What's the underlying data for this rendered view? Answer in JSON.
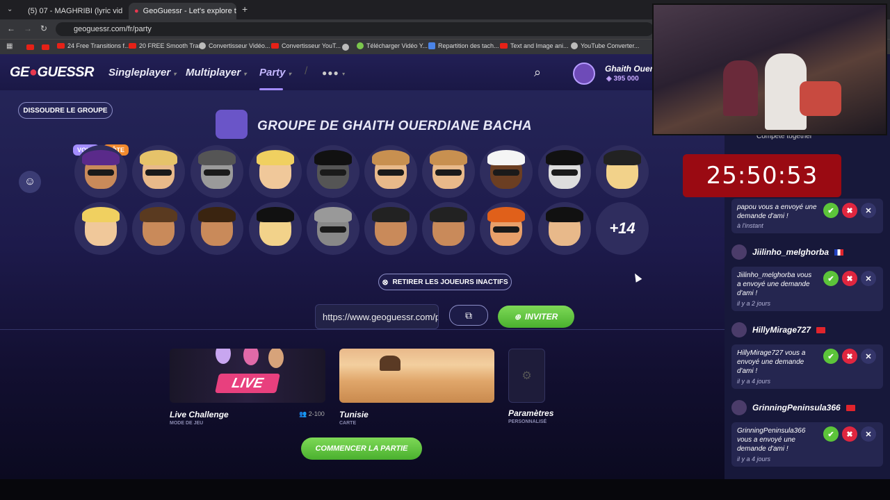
{
  "browser": {
    "tabs": [
      {
        "label": "(5) 07 - MAGHRIBI (lyric vid",
        "active": false
      },
      {
        "label": "GeoGuessr - Let's explore the w",
        "active": true
      }
    ],
    "url": "geoguessr.com/fr/party",
    "bookmarks": [
      "24 Free Transitions f...",
      "20 FREE Smooth Tra...",
      "Convertisseur Vidéo...",
      "Convertisseur YouT...",
      "Télécharger Vidéo Y...",
      "Repartition des tach...",
      "Text and Image ani...",
      "YouTube Converter..."
    ]
  },
  "header": {
    "logo_left": "GE",
    "logo_right": "GUESSR",
    "nav": [
      "Singleplayer",
      "Multiplayer",
      "Party"
    ],
    "user_name": "Ghaith Ouerc",
    "coins": "395 000"
  },
  "party": {
    "dissolve_label": "DISSOUDRE LE GROUPE",
    "title": "GROUPE DE GHAITH OUERDIANE BACHA",
    "badge_you": "VOUS",
    "badge_host": "HÔTE",
    "more_count": "+14",
    "remove_inactive_label": "RETIRER LES JOUEURS INACTIFS",
    "invite_url": "https://www.geoguessr.com/party",
    "invite_label": "INVITER",
    "start_label": "COMMENCER LA PARTIE"
  },
  "cards": {
    "mode": {
      "title": "Live Challenge",
      "sub": "MODE DE JEU",
      "players": "2-100",
      "banner": "LIVE"
    },
    "map": {
      "title": "Tunisie",
      "sub": "CARTE"
    },
    "settings": {
      "title": "Paramètres",
      "sub": "PERSONNALISÉ"
    }
  },
  "stream": {
    "timer": "25:50:53",
    "compete_label": "Compete together"
  },
  "notifications": [
    {
      "text": "papou vous a envoyé une demande d'ami !",
      "time": "à l'instant"
    },
    {
      "friend": "Jiilinho_melghorba",
      "text": "Jiilinho_melghorba vous a envoyé une demande d'ami !",
      "time": "il y a 2 jours"
    },
    {
      "friend": "HillyMirage727",
      "text": "HillyMirage727 vous a envoyé une demande d'ami !",
      "time": "il y a 4 jours"
    },
    {
      "friend": "GrinningPeninsula366",
      "text": "GrinningPeninsula366 vous a envoyé une demande d'ami !",
      "time": "il y a 4 jours"
    }
  ]
}
